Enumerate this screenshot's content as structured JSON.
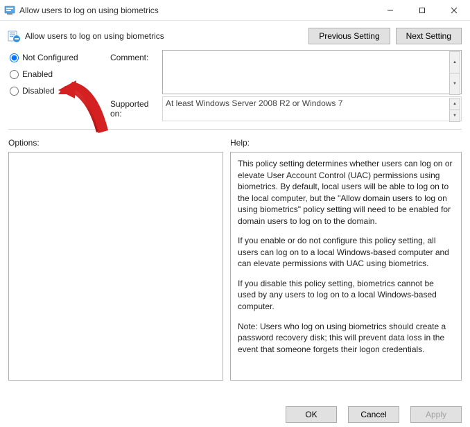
{
  "window": {
    "title": "Allow users to log on using biometrics"
  },
  "header": {
    "policy_title": "Allow users to log on using biometrics",
    "prev_btn": "Previous Setting",
    "next_btn": "Next Setting"
  },
  "settings": {
    "radios": {
      "not_configured": "Not Configured",
      "enabled": "Enabled",
      "disabled": "Disabled",
      "selected": "not_configured"
    },
    "comment_label": "Comment:",
    "comment_value": "",
    "supported_label": "Supported on:",
    "supported_value": "At least Windows Server 2008 R2 or Windows 7"
  },
  "panes": {
    "options_label": "Options:",
    "help_label": "Help:",
    "help_paragraphs": [
      "This policy setting determines whether users can log on or elevate User Account Control (UAC) permissions using biometrics.  By default, local users will be able to log on to the local computer, but the \"Allow domain users to log on using biometrics\" policy setting will need to be enabled for domain users to log on to the domain.",
      "If you enable or do not configure this policy setting, all users can log on to a local Windows-based computer and can elevate permissions with UAC using biometrics.",
      "If you disable this policy setting, biometrics cannot be used by any users to log on to a local Windows-based computer.",
      "Note: Users who log on using biometrics should create a password recovery disk; this will prevent data loss in the event that someone forgets their logon credentials."
    ]
  },
  "footer": {
    "ok": "OK",
    "cancel": "Cancel",
    "apply": "Apply"
  },
  "annotation": {
    "points_to": "enabled",
    "color": "#d42020"
  }
}
